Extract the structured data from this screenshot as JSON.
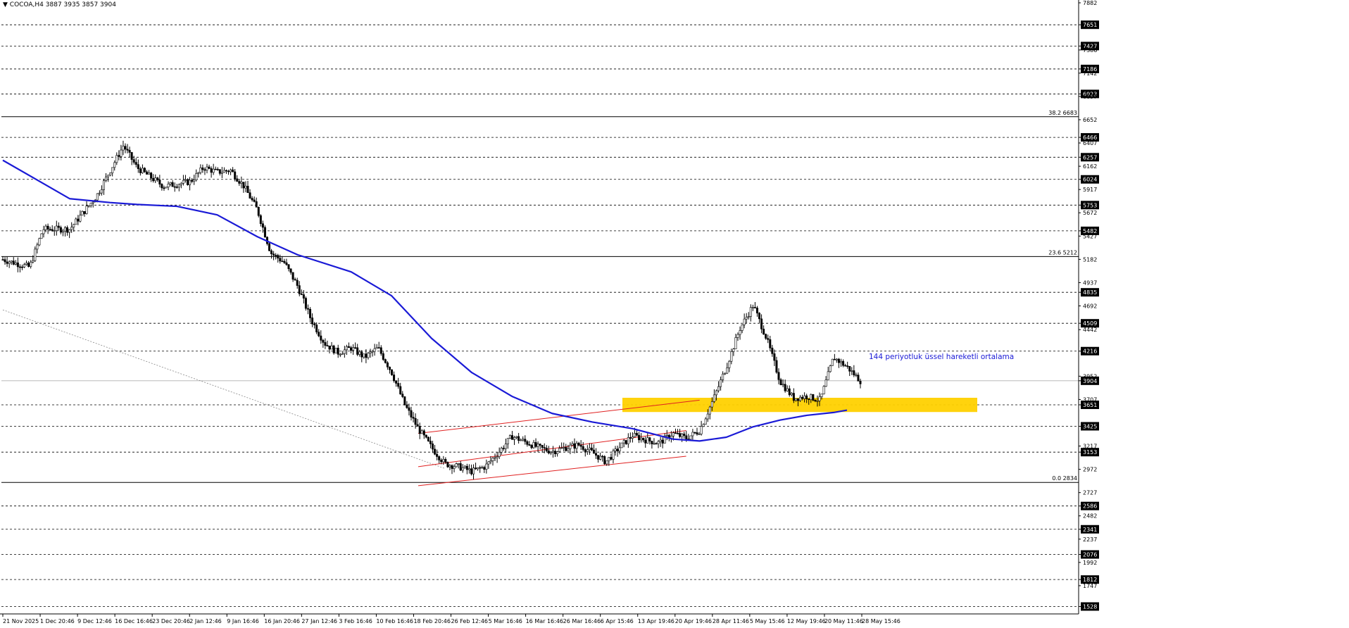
{
  "header": {
    "symbol": "COCOA,H4",
    "ohlc": "3887 3935 3857 3904"
  },
  "colors": {
    "background": "#ffffff",
    "grid_dash": "#000000",
    "bull_candle": "#ffffff",
    "bear_candle": "#000000",
    "ema": "#1a1ad6",
    "channel": "#e02020",
    "zone": "#ffd100",
    "annotation": "#1a1ad6"
  },
  "chart_data": {
    "type": "line",
    "title": "",
    "ylim": [
      1450,
      7882
    ],
    "price_axis_ticks": [
      7882,
      7651,
      7427,
      7386,
      7186,
      7142,
      6923,
      6897,
      6652,
      6466,
      6407,
      6257,
      6162,
      6024,
      5917,
      5753,
      5672,
      5482,
      5427,
      5182,
      4937,
      4835,
      4692,
      4509,
      4442,
      4216,
      3952,
      3904,
      3707,
      3651,
      3425,
      3217,
      3153,
      2972,
      2727,
      2586,
      2482,
      2341,
      2237,
      2076,
      1992,
      1812,
      1747,
      1528
    ],
    "horizontal_levels": [
      7651,
      7427,
      7186,
      6923,
      6466,
      6257,
      6024,
      5753,
      5482,
      4835,
      4509,
      4216,
      3651,
      3425,
      3153,
      2586,
      2341,
      2076,
      1812,
      1528
    ],
    "current_price": 3904,
    "fibonacci": [
      {
        "label": "38.2 6683",
        "value": 6683
      },
      {
        "label": "23.6 5212",
        "value": 5212
      },
      {
        "label": "0.0 2834",
        "value": 2834
      }
    ],
    "x_labels": [
      "21 Nov 2025",
      "1 Dec 20:46",
      "9 Dec 12:46",
      "16 Dec 16:46",
      "23 Dec 20:46",
      "2 Jan 12:46",
      "9 Jan 16:46",
      "16 Jan 20:46",
      "27 Jan 12:46",
      "3 Feb 16:46",
      "10 Feb 16:46",
      "18 Feb 20:46",
      "26 Feb 12:46",
      "5 Mar 16:46",
      "16 Mar 16:46",
      "26 Mar 16:46",
      "6 Apr 15:46",
      "13 Apr 19:46",
      "20 Apr 19:46",
      "28 Apr 11:46",
      "5 May 15:46",
      "12 May 19:46",
      "20 May 11:46",
      "28 May 15:46"
    ],
    "price_path": [
      [
        0,
        5180
      ],
      [
        2,
        5100
      ],
      [
        3,
        5500
      ],
      [
        5,
        5500
      ],
      [
        7,
        5850
      ],
      [
        9,
        6380
      ],
      [
        10,
        6150
      ],
      [
        12,
        5950
      ],
      [
        14,
        6000
      ],
      [
        15,
        6150
      ],
      [
        16,
        6100
      ],
      [
        17,
        6120
      ],
      [
        18,
        5950
      ],
      [
        19,
        5700
      ],
      [
        20,
        5250
      ],
      [
        21,
        5150
      ],
      [
        22,
        4900
      ],
      [
        23,
        4550
      ],
      [
        24,
        4300
      ],
      [
        25,
        4200
      ],
      [
        26,
        4250
      ],
      [
        27,
        4150
      ],
      [
        28,
        4250
      ],
      [
        29,
        4000
      ],
      [
        30,
        3650
      ],
      [
        31,
        3400
      ],
      [
        32,
        3200
      ],
      [
        33,
        3030
      ],
      [
        34,
        3000
      ],
      [
        35,
        2950
      ],
      [
        36,
        3000
      ],
      [
        37,
        3150
      ],
      [
        38,
        3320
      ],
      [
        39,
        3260
      ],
      [
        40,
        3200
      ],
      [
        41,
        3160
      ],
      [
        42,
        3200
      ],
      [
        43,
        3230
      ],
      [
        44,
        3150
      ],
      [
        45,
        3050
      ],
      [
        46,
        3200
      ],
      [
        47,
        3330
      ],
      [
        48,
        3280
      ],
      [
        49,
        3250
      ],
      [
        50,
        3350
      ],
      [
        51,
        3300
      ],
      [
        52,
        3380
      ],
      [
        53,
        3700
      ],
      [
        54,
        4050
      ],
      [
        55,
        4450
      ],
      [
        56,
        4700
      ],
      [
        57,
        4350
      ],
      [
        58,
        3900
      ],
      [
        59,
        3720
      ],
      [
        60,
        3740
      ],
      [
        61,
        3700
      ],
      [
        62,
        4150
      ],
      [
        63,
        4050
      ],
      [
        64,
        3904
      ]
    ],
    "ema_144": [
      [
        0,
        6225
      ],
      [
        5,
        5820
      ],
      [
        8,
        5780
      ],
      [
        10,
        5760
      ],
      [
        13,
        5740
      ],
      [
        16,
        5650
      ],
      [
        19,
        5420
      ],
      [
        22,
        5230
      ],
      [
        26,
        5050
      ],
      [
        29,
        4800
      ],
      [
        32,
        4350
      ],
      [
        35,
        3990
      ],
      [
        38,
        3740
      ],
      [
        41,
        3560
      ],
      [
        44,
        3470
      ],
      [
        47,
        3400
      ],
      [
        50,
        3290
      ],
      [
        52,
        3270
      ],
      [
        54,
        3310
      ],
      [
        56,
        3420
      ],
      [
        58,
        3490
      ],
      [
        60,
        3540
      ],
      [
        62,
        3570
      ],
      [
        63,
        3595
      ]
    ],
    "channel_lines": [
      {
        "from": [
          31,
          3350
        ],
        "to": [
          52,
          3700
        ]
      },
      {
        "from": [
          31,
          3000
        ],
        "to": [
          51,
          3380
        ]
      },
      {
        "from": [
          31,
          2800
        ],
        "to": [
          51,
          3110
        ]
      }
    ],
    "diagonal_line": {
      "from": [
        0,
        4650
      ],
      "to": [
        33,
        2980
      ]
    },
    "zone": {
      "from": 3575,
      "to": 3725
    },
    "annotation": "144 periyotluk üssel hareketli ortalama"
  }
}
